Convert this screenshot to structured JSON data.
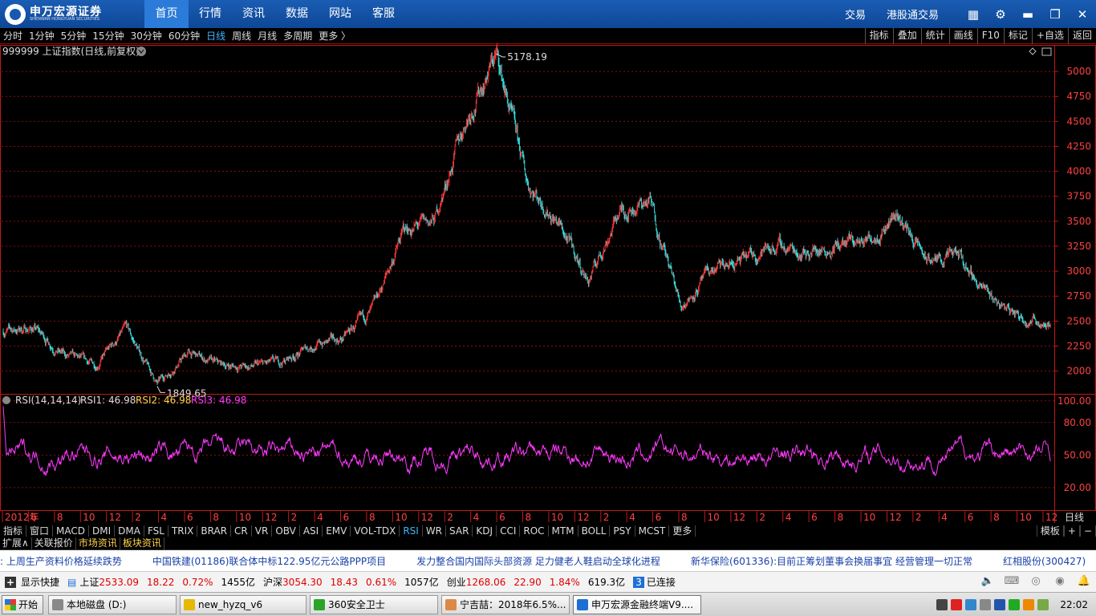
{
  "app": {
    "brand": "申万宏源证券",
    "brand_sub": "SHENWAN HONGYUAN SECURITIES",
    "nav": [
      "首页",
      "行情",
      "资讯",
      "数据",
      "网站",
      "客服"
    ],
    "nav_active": 0,
    "right_links": [
      "交易",
      "港股通交易"
    ],
    "icons": [
      "grid-icon",
      "gear-icon",
      "minimize-icon",
      "restore-icon",
      "close-icon"
    ]
  },
  "periods": {
    "items": [
      "分时",
      "1分钟",
      "5分钟",
      "15分钟",
      "30分钟",
      "60分钟",
      "日线",
      "周线",
      "月线",
      "多周期",
      "更多 〉"
    ],
    "selected": 6,
    "tools": [
      "指标",
      "叠加",
      "统计",
      "画线",
      "F10",
      "标记",
      "+自选",
      "返回"
    ]
  },
  "main_chart": {
    "title": "999999 上证指数(日线,前复权)",
    "high_label": "5178.19",
    "low_label": "1849.65",
    "y_ticks": [
      2000,
      2250,
      2500,
      2750,
      3000,
      3250,
      3500,
      3750,
      4000,
      4250,
      4500,
      4750,
      5000
    ],
    "ylim": [
      1780,
      5250
    ]
  },
  "rsi": {
    "title": "RSI(14,14,14)",
    "l1": "RSI1: 46.98",
    "l2": "RSI2: 46.98",
    "l3": "RSI3: 46.98",
    "y_ticks": [
      "100.00",
      "80.00",
      "50.00",
      "20.00"
    ],
    "ylim": [
      0,
      105
    ]
  },
  "x_axis": {
    "labels": [
      "2012年",
      "6",
      "8",
      "10",
      "12",
      "2",
      "4",
      "6",
      "8",
      "10",
      "12",
      "2",
      "4",
      "6",
      "8",
      "10",
      "12",
      "2",
      "4",
      "6",
      "8",
      "10",
      "12",
      "2",
      "4",
      "6",
      "8",
      "10",
      "12",
      "2",
      "4",
      "6",
      "8",
      "10",
      "12",
      "2",
      "4",
      "6",
      "8",
      "10",
      "12"
    ],
    "period_label": "日线"
  },
  "chart_data": {
    "type": "line",
    "title": "999999 上证指数(日线,前复权)",
    "ylim": [
      1780,
      5250
    ],
    "x": [
      "2012-03",
      "2012-06",
      "2012-09",
      "2012-12",
      "2013-02",
      "2013-06",
      "2013-09",
      "2014-01",
      "2014-04",
      "2014-07",
      "2014-09",
      "2014-11",
      "2015-01",
      "2015-03",
      "2015-05",
      "2015-06",
      "2015-07",
      "2015-08",
      "2015-09",
      "2015-11",
      "2015-12",
      "2016-01",
      "2016-03",
      "2016-07",
      "2016-11",
      "2017-01",
      "2017-05",
      "2017-09",
      "2018-01",
      "2018-02",
      "2018-04",
      "2018-06",
      "2018-08",
      "2018-10",
      "2018-12"
    ],
    "series": [
      {
        "values": [
          2400,
          2430,
          2150,
          2060,
          2420,
          1870,
          2180,
          2060,
          2040,
          2080,
          2250,
          2320,
          2600,
          3400,
          3500,
          4500,
          5178,
          3900,
          3500,
          2900,
          3600,
          3700,
          2650,
          3000,
          3100,
          3260,
          3200,
          3250,
          3300,
          3587,
          3100,
          3150,
          2750,
          2550,
          2480
        ]
      }
    ],
    "annotations": [
      "5178.19",
      "1849.65"
    ]
  },
  "indicator_tabs": {
    "items": [
      "指标",
      "窗口",
      "MACD",
      "DMI",
      "DMA",
      "FSL",
      "TRIX",
      "BRAR",
      "CR",
      "VR",
      "OBV",
      "ASI",
      "EMV",
      "VOL-TDX",
      "RSI",
      "WR",
      "SAR",
      "KDJ",
      "CCI",
      "ROC",
      "MTM",
      "BOLL",
      "PSY",
      "MCST",
      "更多"
    ],
    "selected": 14,
    "right": [
      "模板",
      "+",
      "−"
    ]
  },
  "ext_tabs": [
    "扩展∧",
    "关联报价",
    "市场资讯",
    "板块资讯"
  ],
  "ticker": [
    ": 上周生产资料价格延续跌势",
    "中国铁建(01186)联合体中标122.95亿元公路PPP项目",
    "发力整合国内国际头部资源  足力健老人鞋启动全球化进程",
    "新华保险(601336):目前正筹划董事会换届事宜  经营管理一切正常",
    "红相股份(300427)"
  ],
  "status": {
    "show_quick": "显示快捷",
    "sh_label": "上证",
    "sh_val": "2533.09",
    "sh_chg": "18.22",
    "sh_pct": "0.72%",
    "sh_amt": "1455亿",
    "hs_label": "沪深",
    "hs_val": "3054.30",
    "hs_chg": "18.43",
    "hs_pct": "0.61%",
    "hs_amt": "1057亿",
    "cy_label": "创业",
    "cy_val": "1268.06",
    "cy_chg": "22.90",
    "cy_pct": "1.84%",
    "cy_amt": "619.3亿",
    "conn_count": "3",
    "conn_label": "已连接"
  },
  "taskbar": {
    "start": "开始",
    "buttons": [
      "本地磁盘 (D:)",
      "new_hyzq_v6",
      "360安全卫士",
      "宁吉喆：2018年6.5%...",
      "申万宏源金融终端V9...."
    ],
    "clock": "22:02"
  },
  "colors": {
    "up": "#ff3a3a",
    "down": "#39e0e0",
    "rsi": "#ff3aff",
    "grid": "#8a1010",
    "axis": "#c01818"
  }
}
